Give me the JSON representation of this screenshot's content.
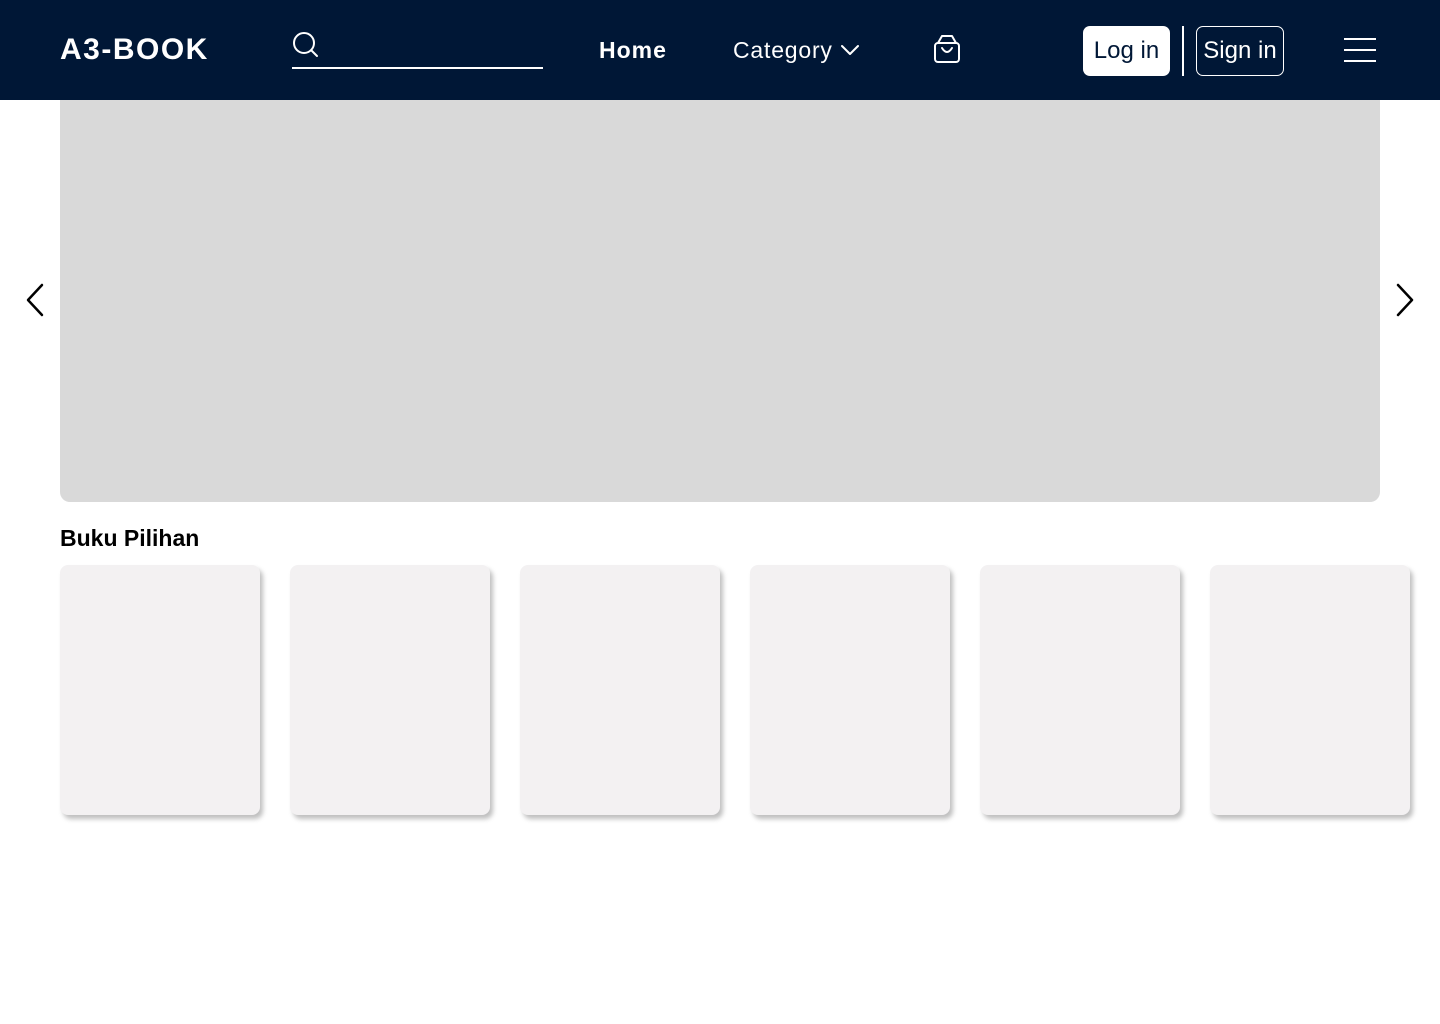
{
  "header": {
    "logo": "A3-BOOK",
    "search": {
      "value": "",
      "placeholder": "",
      "icon": "search-icon"
    },
    "nav": {
      "home_label": "Home",
      "category_label": "Category",
      "category_icon": "chevron-down-icon"
    },
    "cart_icon": "shopping-bag-icon",
    "login_label": "Log in",
    "signin_label": "Sign in",
    "menu_icon": "hamburger-menu-icon"
  },
  "carousel": {
    "prev_icon": "chevron-left-icon",
    "next_icon": "chevron-right-icon"
  },
  "featured": {
    "title": "Buku Pilihan",
    "card_count": 6
  },
  "colors": {
    "navbar_bg": "#001736",
    "hero_placeholder": "#d9d9d9",
    "card_bg": "#f3f1f2",
    "text_light": "#ffffff",
    "text_dark": "#000000"
  }
}
